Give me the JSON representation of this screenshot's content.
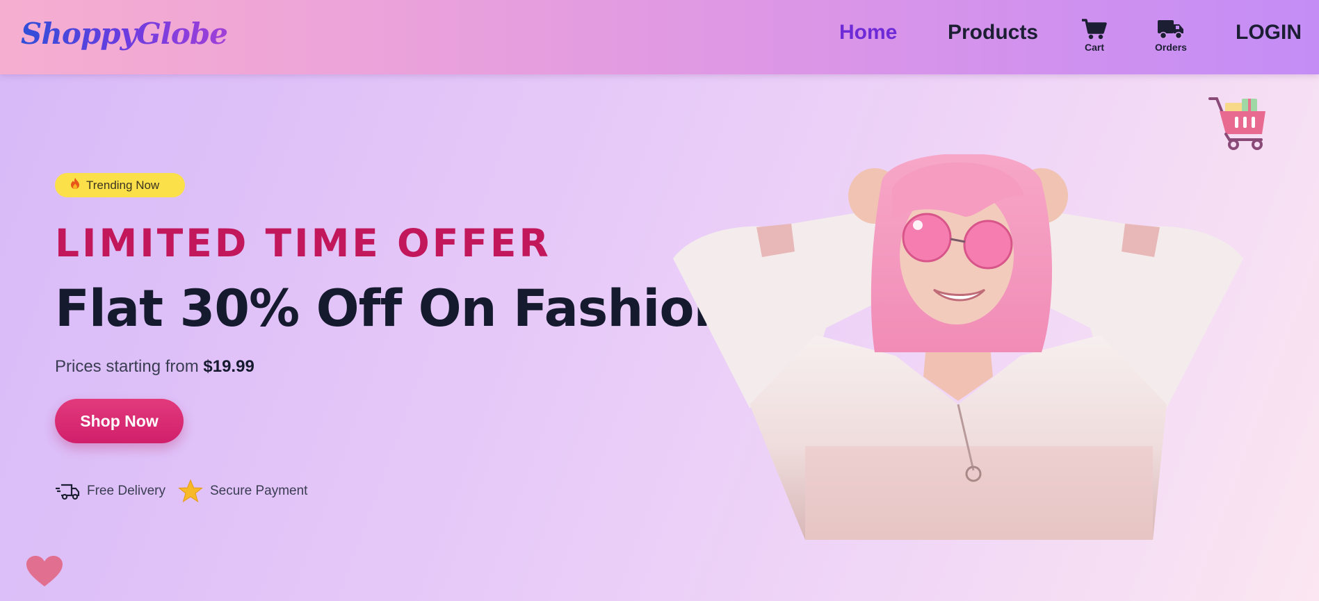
{
  "header": {
    "logo": "ShoppyGlobe",
    "nav": {
      "home": "Home",
      "products": "Products",
      "cart": "Cart",
      "orders": "Orders",
      "login": "LOGIN"
    }
  },
  "hero": {
    "badge": "Trending Now",
    "offer_title": "LIMITED TIME OFFER",
    "headline": "Flat 30% Off On Fashion",
    "price_prefix": "Prices starting from ",
    "price_value": "$19.99",
    "cta": "Shop Now",
    "features": [
      {
        "icon": "delivery-truck-icon",
        "label": "Free Delivery"
      },
      {
        "icon": "star-icon",
        "label": "Secure Payment"
      }
    ]
  },
  "colors": {
    "accent": "#c2185b",
    "nav_active": "#6d2ad6",
    "badge": "#fbe04a",
    "button": "#d11f6b"
  }
}
